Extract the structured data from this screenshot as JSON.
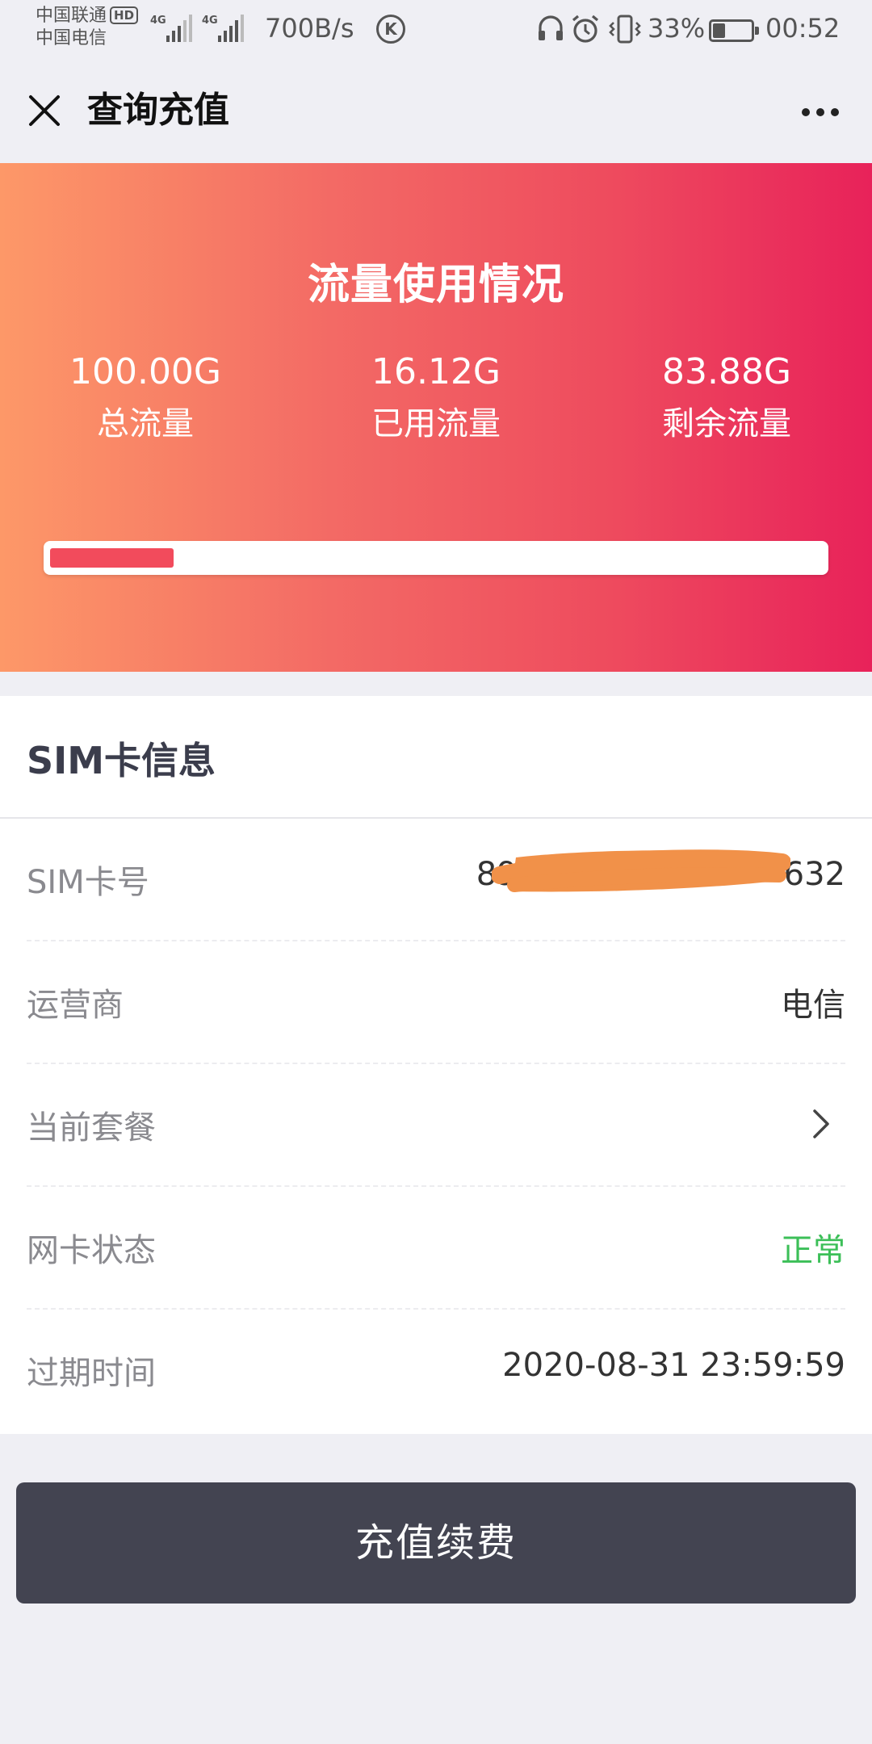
{
  "status_bar": {
    "carrier_1": "中国联通",
    "hd_badge": "HD",
    "carrier_2": "中国电信",
    "network_1": "4G",
    "network_2": "4G",
    "net_speed": "700B/s",
    "k_badge": "K",
    "battery_percent": "33%",
    "battery_level": 0.33,
    "time": "00:52",
    "icons": [
      "headset-icon",
      "alarm-icon",
      "vibrate-icon",
      "battery-icon"
    ]
  },
  "nav": {
    "title": "查询充值",
    "close_icon": "close-icon",
    "more_icon": "more-icon"
  },
  "usage": {
    "title": "流量使用情况",
    "stats": [
      {
        "value": "100.00G",
        "label": "总流量"
      },
      {
        "value": "16.12G",
        "label": "已用流量"
      },
      {
        "value": "83.88G",
        "label": "剩余流量"
      }
    ],
    "used_fraction": 0.16,
    "colors": {
      "gradient_start": "#fd9868",
      "gradient_end": "#e8225a",
      "progress_fill": "#f24b5c"
    }
  },
  "sim_info": {
    "title": "SIM卡信息",
    "rows": [
      {
        "label": "SIM卡号",
        "value_start": "89",
        "value_end": "632"
      },
      {
        "label": "运营商",
        "value": "电信"
      },
      {
        "label": "当前套餐",
        "value": ""
      },
      {
        "label": "网卡状态",
        "value": "正常",
        "value_color": "#3cbf58"
      },
      {
        "label": "过期时间",
        "value": "2020-08-31 23:59:59"
      }
    ]
  },
  "actions": {
    "recharge_label": "充值续费",
    "button_color": "#434451"
  }
}
